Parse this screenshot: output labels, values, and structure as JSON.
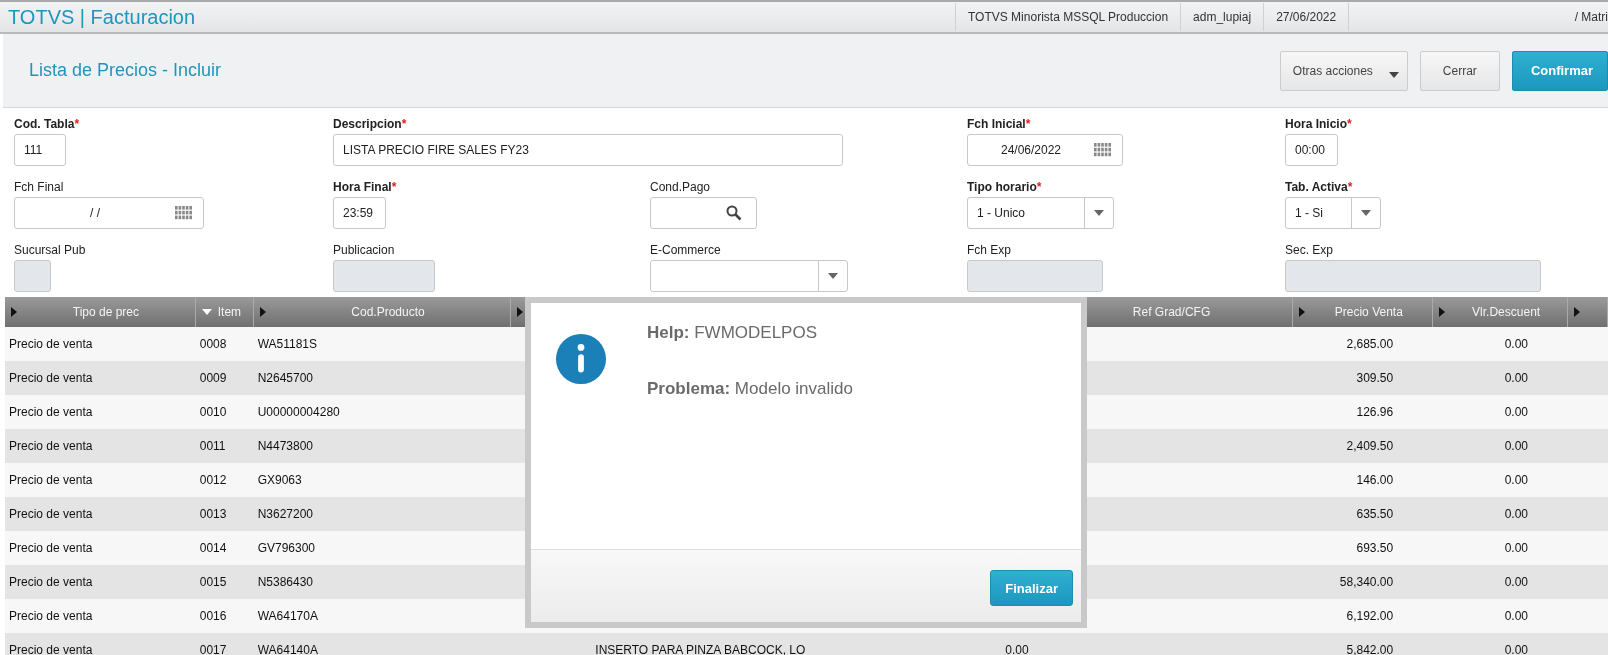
{
  "app_bar": {
    "title": "TOTVS | Facturacion",
    "segments": [
      "TOTVS Minorista MSSQL Produccion",
      "adm_lupiaj",
      "27/06/2022"
    ],
    "branch": "/ Matri"
  },
  "page": {
    "title": "Lista de Precios - Incluir",
    "buttons": [
      {
        "label": "Otras acciones",
        "kind": "menu"
      },
      {
        "label": "Cerrar",
        "kind": "default"
      },
      {
        "label": "Confirmar",
        "kind": "primary"
      }
    ]
  },
  "form": {
    "fields": [
      {
        "label": "Cod. Tabla",
        "required": true,
        "mark": "*",
        "kind": "text",
        "value": "111"
      },
      {
        "label": "Descripcion",
        "required": true,
        "mark": "*",
        "kind": "text",
        "value": "LISTA PRECIO FIRE SALES FY23"
      },
      {
        "kind": "empty"
      },
      {
        "label": "Fch Inicial",
        "required": true,
        "mark": "*",
        "kind": "date",
        "value": "24/06/2022"
      },
      {
        "label": "Hora Inicio",
        "required": true,
        "mark": "*",
        "kind": "text",
        "value": "00:00"
      },
      {
        "label": "Fch Final",
        "required": false,
        "kind": "date",
        "value": "/ /"
      },
      {
        "label": "Hora Final",
        "required": true,
        "mark": "*",
        "kind": "text",
        "value": "23:59"
      },
      {
        "label": "Cond.Pago",
        "required": false,
        "kind": "lookup"
      },
      {
        "label": "Tipo horario",
        "required": true,
        "mark": "*",
        "kind": "select",
        "value": "1 - Unico"
      },
      {
        "label": "Tab. Activa",
        "required": true,
        "mark": "*",
        "kind": "select",
        "value": "1 - Si"
      },
      {
        "label": "Sucursal Pub",
        "required": false,
        "kind": "disabled"
      },
      {
        "label": "Publicacion",
        "required": false,
        "kind": "disabled"
      },
      {
        "label": "E-Commerce",
        "required": false,
        "kind": "select"
      },
      {
        "label": "Fch Exp",
        "required": false,
        "kind": "disabled"
      },
      {
        "label": "Sec. Exp",
        "required": false,
        "kind": "disabled"
      }
    ]
  },
  "table": {
    "columns": [
      {
        "label": "Tipo de prec",
        "sorted": false
      },
      {
        "label": "Item",
        "sorted": true
      },
      {
        "label": "Cod.Producto",
        "sorted": false
      },
      {
        "sorted": false
      },
      {},
      {
        "label": "Ref Grad/CFG",
        "sorted": false
      },
      {
        "label": "Precio Venta",
        "sorted": false
      },
      {
        "label": "Vlr.Descuent",
        "sorted": false
      },
      {
        "sorted": false
      }
    ],
    "rows": [
      {
        "cells": [
          "Precio de venta",
          "0008",
          "WA51181S",
          "",
          "",
          "",
          "2,685.00",
          "0.00",
          ""
        ]
      },
      {
        "cells": [
          "Precio de venta",
          "0009",
          "N2645700",
          "",
          "",
          "",
          "309.50",
          "0.00",
          ""
        ]
      },
      {
        "cells": [
          "Precio de venta",
          "0010",
          "U00000004280",
          "",
          "",
          "",
          "126.96",
          "0.00",
          ""
        ]
      },
      {
        "cells": [
          "Precio de venta",
          "0011",
          "N4473800",
          "",
          "",
          "",
          "2,409.50",
          "0.00",
          ""
        ]
      },
      {
        "cells": [
          "Precio de venta",
          "0012",
          "GX9063",
          "",
          "",
          "",
          "146.00",
          "0.00",
          ""
        ]
      },
      {
        "cells": [
          "Precio de venta",
          "0013",
          "N3627200",
          "",
          "",
          "",
          "635.50",
          "0.00",
          ""
        ]
      },
      {
        "cells": [
          "Precio de venta",
          "0014",
          "GV796300",
          "",
          "",
          "",
          "693.50",
          "0.00",
          ""
        ]
      },
      {
        "cells": [
          "Precio de venta",
          "0015",
          "N5386430",
          "",
          "",
          "",
          "58,340.00",
          "0.00",
          ""
        ]
      },
      {
        "cells": [
          "Precio de venta",
          "0016",
          "WA64170A",
          "",
          "",
          "",
          "6,192.00",
          "0.00",
          ""
        ]
      },
      {
        "cells": [
          "Precio de venta",
          "0017",
          "WA64140A",
          "INSERTO PARA PINZA BABCOCK, LO",
          "0.00",
          "",
          "5,842.00",
          "0.00",
          ""
        ]
      }
    ]
  },
  "dialog": {
    "help": "**Help:** FWMODELPOS",
    "problem": "**Problema:** Modelo invalido",
    "button": "Finalizar"
  }
}
